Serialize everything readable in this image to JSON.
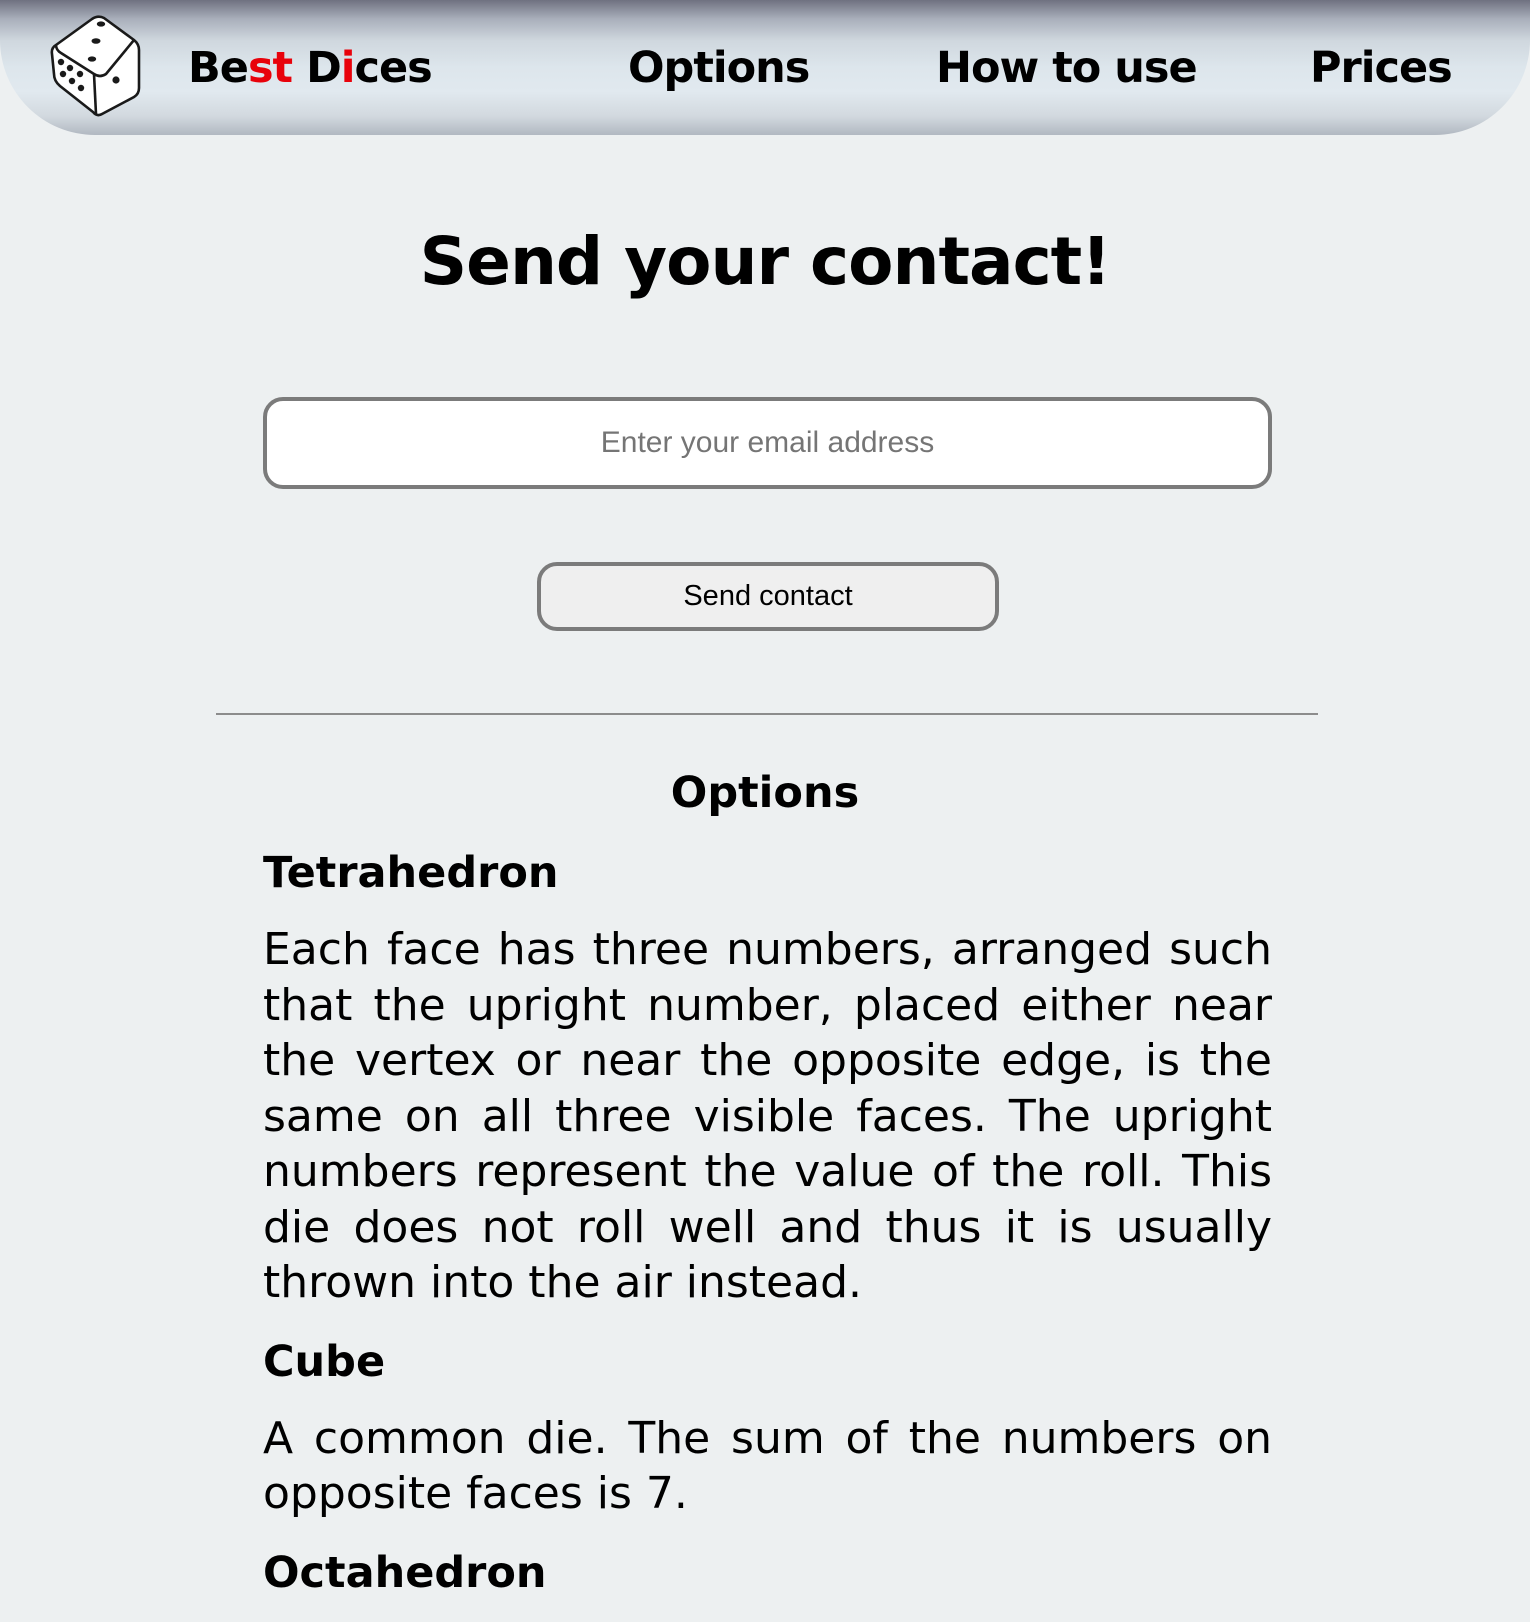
{
  "header": {
    "brand": {
      "segments": [
        "Be",
        "st",
        " D",
        "i",
        "ces"
      ],
      "accent_color": "#e8020b"
    },
    "logo_icon": "dice-icon",
    "nav": [
      {
        "label": "Options"
      },
      {
        "label": "How to use"
      },
      {
        "label": "Prices"
      }
    ]
  },
  "contact": {
    "title": "Send your contact!",
    "email_placeholder": "Enter your email address",
    "button_label": "Send contact"
  },
  "options": {
    "title": "Options",
    "items": [
      {
        "name": "Tetrahedron",
        "description": "Each face has three numbers, arranged such that the upright number, placed either near the vertex or near the opposite edge, is the same on all three visible faces. The upright numbers represent the value of the roll. This die does not roll well and thus it is usually thrown into the air instead."
      },
      {
        "name": "Cube",
        "description": "A common die. The sum of the numbers on opposite faces is 7."
      },
      {
        "name": "Octahedron",
        "description": ""
      }
    ]
  }
}
